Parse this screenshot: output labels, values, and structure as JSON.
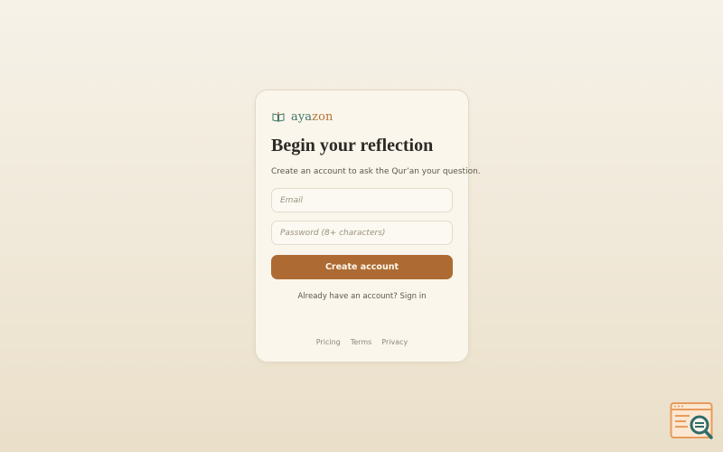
{
  "brand": {
    "name_part1": "aya",
    "name_part2": "zon",
    "logo_icon": "open-book-icon",
    "colors": {
      "primary": "#3f7565",
      "accent": "#b47235"
    }
  },
  "signup": {
    "title": "Begin your reflection",
    "subtitle": "Create an account to ask the Qur’an your question.",
    "email_placeholder": "Email",
    "password_placeholder": "Password (8+ characters)",
    "submit_label": "Create account",
    "signin_text": "Already have an account? Sign in"
  },
  "footer": {
    "links": [
      "Pricing",
      "Terms",
      "Privacy"
    ]
  },
  "widget": {
    "icon": "browser-search-icon"
  }
}
